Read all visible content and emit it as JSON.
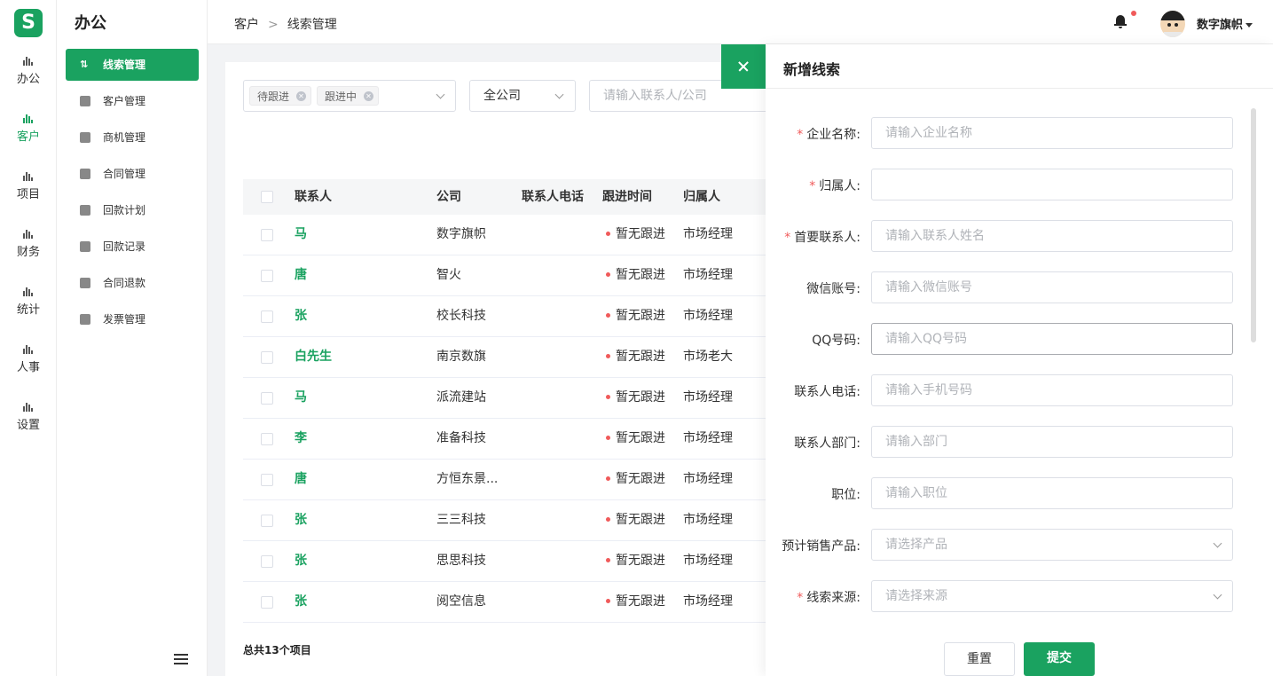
{
  "app": {
    "logo_letter": "S"
  },
  "rail": {
    "items": [
      {
        "label": "办公",
        "icon": "bar-chart-icon"
      },
      {
        "label": "客户",
        "icon": "bar-chart-icon"
      },
      {
        "label": "项目",
        "icon": "bar-chart-icon"
      },
      {
        "label": "财务",
        "icon": "bar-chart-icon"
      },
      {
        "label": "统计",
        "icon": "bar-chart-icon"
      },
      {
        "label": "人事",
        "icon": "bar-chart-icon"
      },
      {
        "label": "设置",
        "icon": "bar-chart-icon"
      }
    ],
    "active": "客户"
  },
  "submenu": {
    "title": "办公",
    "items": [
      {
        "label": "线索管理",
        "icon": "sort-icon"
      },
      {
        "label": "客户管理",
        "icon": "users-icon"
      },
      {
        "label": "商机管理",
        "icon": "briefcase-icon"
      },
      {
        "label": "合同管理",
        "icon": "contract-icon"
      },
      {
        "label": "回款计划",
        "icon": "payment-plan-icon"
      },
      {
        "label": "回款记录",
        "icon": "record-icon"
      },
      {
        "label": "合同退款",
        "icon": "refund-icon"
      },
      {
        "label": "发票管理",
        "icon": "invoice-icon"
      }
    ],
    "active": "线索管理"
  },
  "header": {
    "breadcrumb": [
      "客户",
      "线索管理"
    ],
    "separator": ">",
    "username": "数字旗帜",
    "notification_dot_color": "#f05a5a"
  },
  "filters": {
    "tags": [
      "待跟进",
      "跟进中"
    ],
    "company_select": "全公司",
    "search_placeholder": "请输入联系人/公司"
  },
  "table": {
    "columns": [
      "联系人",
      "公司",
      "联系人电话",
      "跟进时间",
      "归属人"
    ],
    "rows": [
      {
        "contact": "马",
        "company": "数字旗帜",
        "phone": "",
        "follow": "暂无跟进",
        "owner": "市场经理"
      },
      {
        "contact": "唐",
        "company": "智火",
        "phone": "",
        "follow": "暂无跟进",
        "owner": "市场经理"
      },
      {
        "contact": "张",
        "company": "校长科技",
        "phone": "",
        "follow": "暂无跟进",
        "owner": "市场经理"
      },
      {
        "contact": "白先生",
        "company": "南京数旗",
        "phone": "",
        "follow": "暂无跟进",
        "owner": "市场老大"
      },
      {
        "contact": "马",
        "company": "派流建站",
        "phone": "",
        "follow": "暂无跟进",
        "owner": "市场经理"
      },
      {
        "contact": "李",
        "company": "准备科技",
        "phone": "",
        "follow": "暂无跟进",
        "owner": "市场经理"
      },
      {
        "contact": "唐",
        "company": "方恒东景...",
        "phone": "",
        "follow": "暂无跟进",
        "owner": "市场经理"
      },
      {
        "contact": "张",
        "company": "三三科技",
        "phone": "",
        "follow": "暂无跟进",
        "owner": "市场经理"
      },
      {
        "contact": "张",
        "company": "思思科技",
        "phone": "",
        "follow": "暂无跟进",
        "owner": "市场经理"
      },
      {
        "contact": "张",
        "company": "阅空信息",
        "phone": "",
        "follow": "暂无跟进",
        "owner": "市场经理"
      }
    ],
    "total": "总共13个项目"
  },
  "drawer": {
    "title": "新增线索",
    "fields": [
      {
        "label": "企业名称:",
        "required": true,
        "type": "input",
        "placeholder": "请输入企业名称"
      },
      {
        "label": "归属人:",
        "required": true,
        "type": "input",
        "placeholder": ""
      },
      {
        "label": "首要联系人:",
        "required": true,
        "type": "input",
        "placeholder": "请输入联系人姓名"
      },
      {
        "label": "微信账号:",
        "required": false,
        "type": "input",
        "placeholder": "请输入微信账号"
      },
      {
        "label": "QQ号码:",
        "required": false,
        "type": "input",
        "placeholder": "请输入QQ号码"
      },
      {
        "label": "联系人电话:",
        "required": false,
        "type": "input",
        "placeholder": "请输入手机号码"
      },
      {
        "label": "联系人部门:",
        "required": false,
        "type": "input",
        "placeholder": "请输入部门"
      },
      {
        "label": "职位:",
        "required": false,
        "type": "input",
        "placeholder": "请输入职位"
      },
      {
        "label": "预计销售产品:",
        "required": false,
        "type": "select",
        "placeholder": "请选择产品"
      },
      {
        "label": "线索来源:",
        "required": true,
        "type": "select",
        "placeholder": "请选择来源"
      }
    ],
    "reset_label": "重置",
    "submit_label": "提交"
  },
  "colors": {
    "accent": "#1aa260",
    "danger": "#f05a5a"
  }
}
